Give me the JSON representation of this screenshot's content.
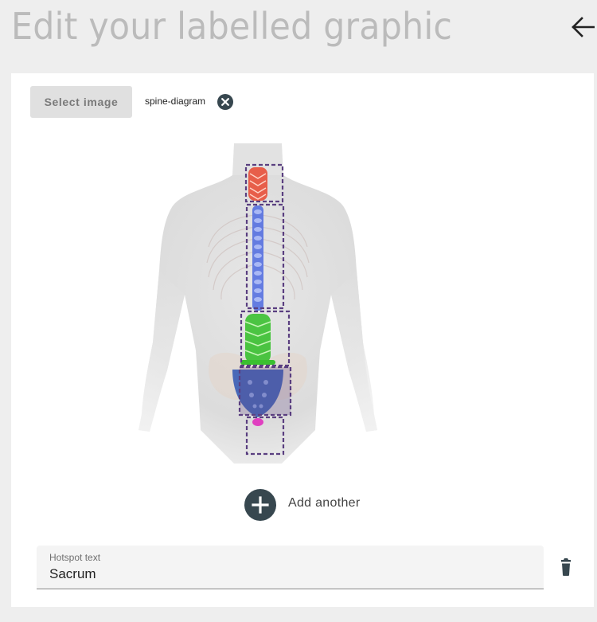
{
  "header": {
    "title": "Edit your labelled graphic",
    "back_icon": "arrow-left-icon"
  },
  "image_selector": {
    "button_label": "Select image",
    "selected_file": "spine-diagram",
    "remove_icon": "close-circle-icon"
  },
  "graphic": {
    "image": "spine-diagram",
    "hotspot_count": 5,
    "region_colors": {
      "cervical": "#e8503a",
      "thoracic": "#5570e0",
      "lumbar": "#3ac030",
      "sacrum": "#3c5fb5",
      "coccyx": "#e040c0"
    },
    "hotspot_border_color": "#5a3f80"
  },
  "add_another": {
    "label": "Add another",
    "icon": "plus-icon"
  },
  "hotspot": {
    "field_label": "Hotspot text",
    "value": "Sacrum",
    "delete_icon": "trash-icon"
  }
}
